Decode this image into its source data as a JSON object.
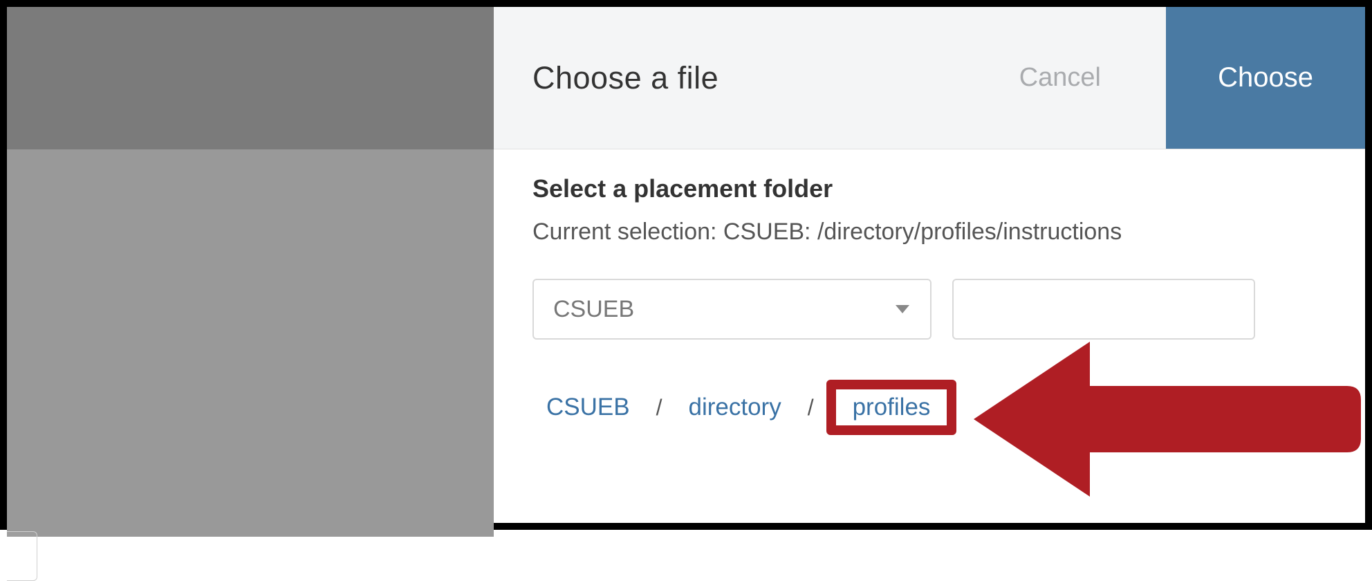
{
  "header": {
    "title": "Choose a file",
    "cancel_label": "Cancel",
    "choose_label": "Choose"
  },
  "body": {
    "subheading": "Select a placement folder",
    "current_selection_prefix": "Current selection: ",
    "current_selection_value": "CSUEB: /directory/profiles/instructions",
    "dropdown_value": "CSUEB",
    "textbox_value": ""
  },
  "breadcrumb": {
    "items": [
      {
        "label": "CSUEB"
      },
      {
        "label": "directory"
      },
      {
        "label": "profiles"
      }
    ],
    "separator": "/"
  },
  "annotation": {
    "arrow_color": "#af1e24",
    "highlight_index": 2
  }
}
